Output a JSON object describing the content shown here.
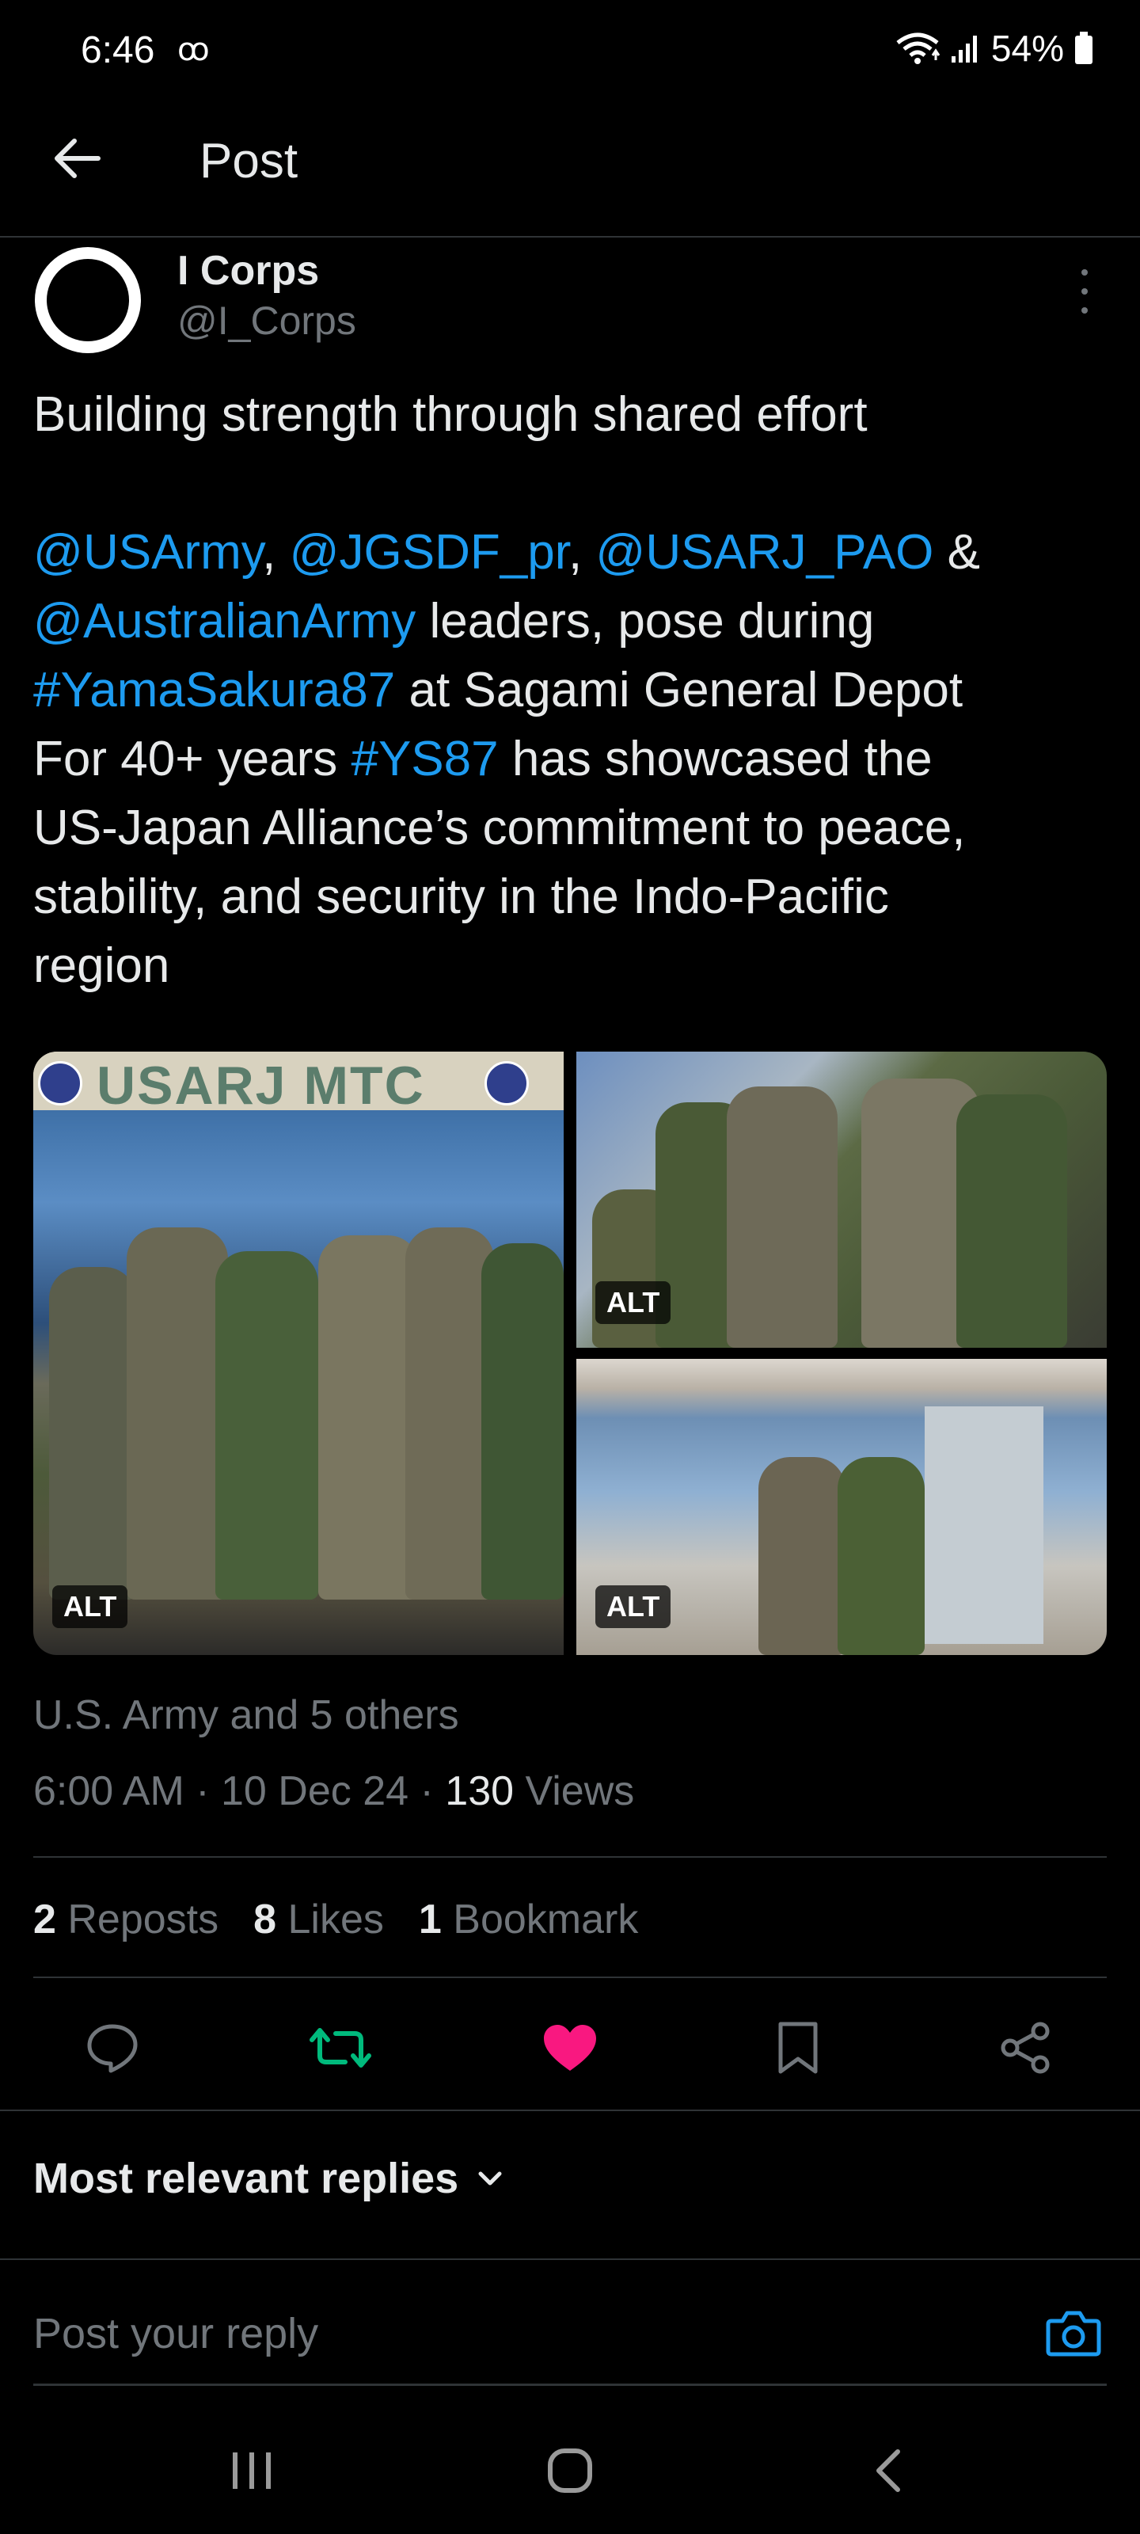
{
  "status_bar": {
    "time": "6:46",
    "voicemail": "ꝏ",
    "battery": "54%"
  },
  "header": {
    "title": "Post"
  },
  "author": {
    "name": "I Corps",
    "handle": "@I_Corps"
  },
  "tweet": {
    "line1": "Building strength through shared effort",
    "mention_usarmy": "@USArmy",
    "comma1": ", ",
    "mention_jgsdf": "@JGSDF_pr",
    "comma2": ", ",
    "mention_usarj": "@USARJ_PAO",
    "amp": " &",
    "mention_australian": "@AustralianArmy",
    "text_pose": " leaders, pose during",
    "hashtag_yama": "#YamaSakura87",
    "text_sagami": " at Sagami General Depot",
    "text_for40": "For 40+ years ",
    "hashtag_ys87": "#YS87",
    "text_showcased": " has showcased the",
    "line_alliance": "US-Japan Alliance’s commitment to peace,",
    "line_stability": "stability, and security in the Indo-Pacific",
    "line_region": "region"
  },
  "media": {
    "sign_text": "USARJ   MTC",
    "alt_label": "ALT"
  },
  "meta": {
    "reposted_by": "U.S. Army and 5 others",
    "time": "6:00 AM",
    "separator": " · ",
    "date": "10 Dec 24",
    "views_count": "130",
    "views_label": " Views"
  },
  "stats": {
    "reposts_count": "2",
    "reposts_label": " Reposts",
    "likes_count": "8",
    "likes_label": " Likes",
    "bookmarks_count": "1",
    "bookmarks_label": " Bookmark"
  },
  "actions": {
    "reply_icon": "reply-icon",
    "repost_icon": "repost-icon",
    "like_icon": "heart-icon",
    "bookmark_icon": "bookmark-icon",
    "share_icon": "share-icon",
    "repost_color": "#00ba7c",
    "like_color": "#f91880"
  },
  "replies": {
    "sort_label": "Most relevant replies",
    "reply_placeholder": "Post your reply"
  },
  "colors": {
    "background": "#000000",
    "link": "#1d9bf0",
    "muted": "#71767b",
    "camera": "#1d9bf0"
  }
}
